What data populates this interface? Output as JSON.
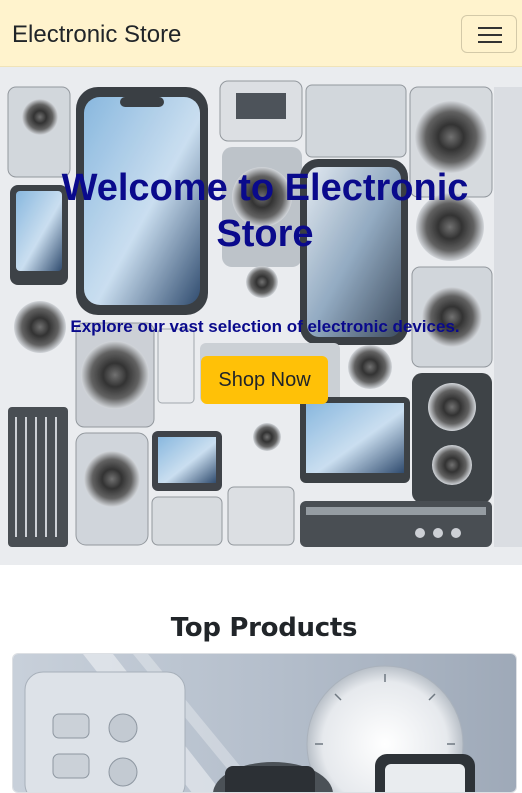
{
  "navbar": {
    "brand": "Electronic Store",
    "toggler_icon": "hamburger-menu-icon"
  },
  "hero": {
    "title": "Welcome to Electronic Store",
    "subtitle": "Explore our vast selection of electronic devices.",
    "cta_label": "Shop Now",
    "title_color": "#0a0a8c",
    "cta_color": "#ffc107"
  },
  "products": {
    "heading": "Top Products"
  },
  "colors": {
    "navbar_bg": "#fff3cd"
  }
}
